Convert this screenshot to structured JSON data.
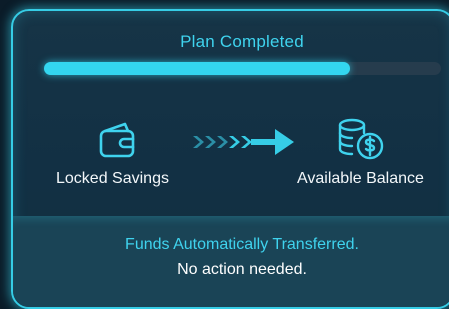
{
  "plan": {
    "title": "Plan Completed",
    "progress_fraction": 0.77
  },
  "flow": {
    "source_label": "Locked Savings",
    "source_icon": "wallet-icon",
    "arrow_icon": "arrow-right-icon",
    "destination_label": "Available Balance",
    "destination_icon": "coins-dollar-icon"
  },
  "footer": {
    "message": "Funds Automatically Transferred.",
    "submessage": "No action needed."
  },
  "colors": {
    "accent": "#36cde6",
    "background": "#0b1c29",
    "panel": "#163446",
    "footer": "#1a4456",
    "text": "#ffffff"
  }
}
